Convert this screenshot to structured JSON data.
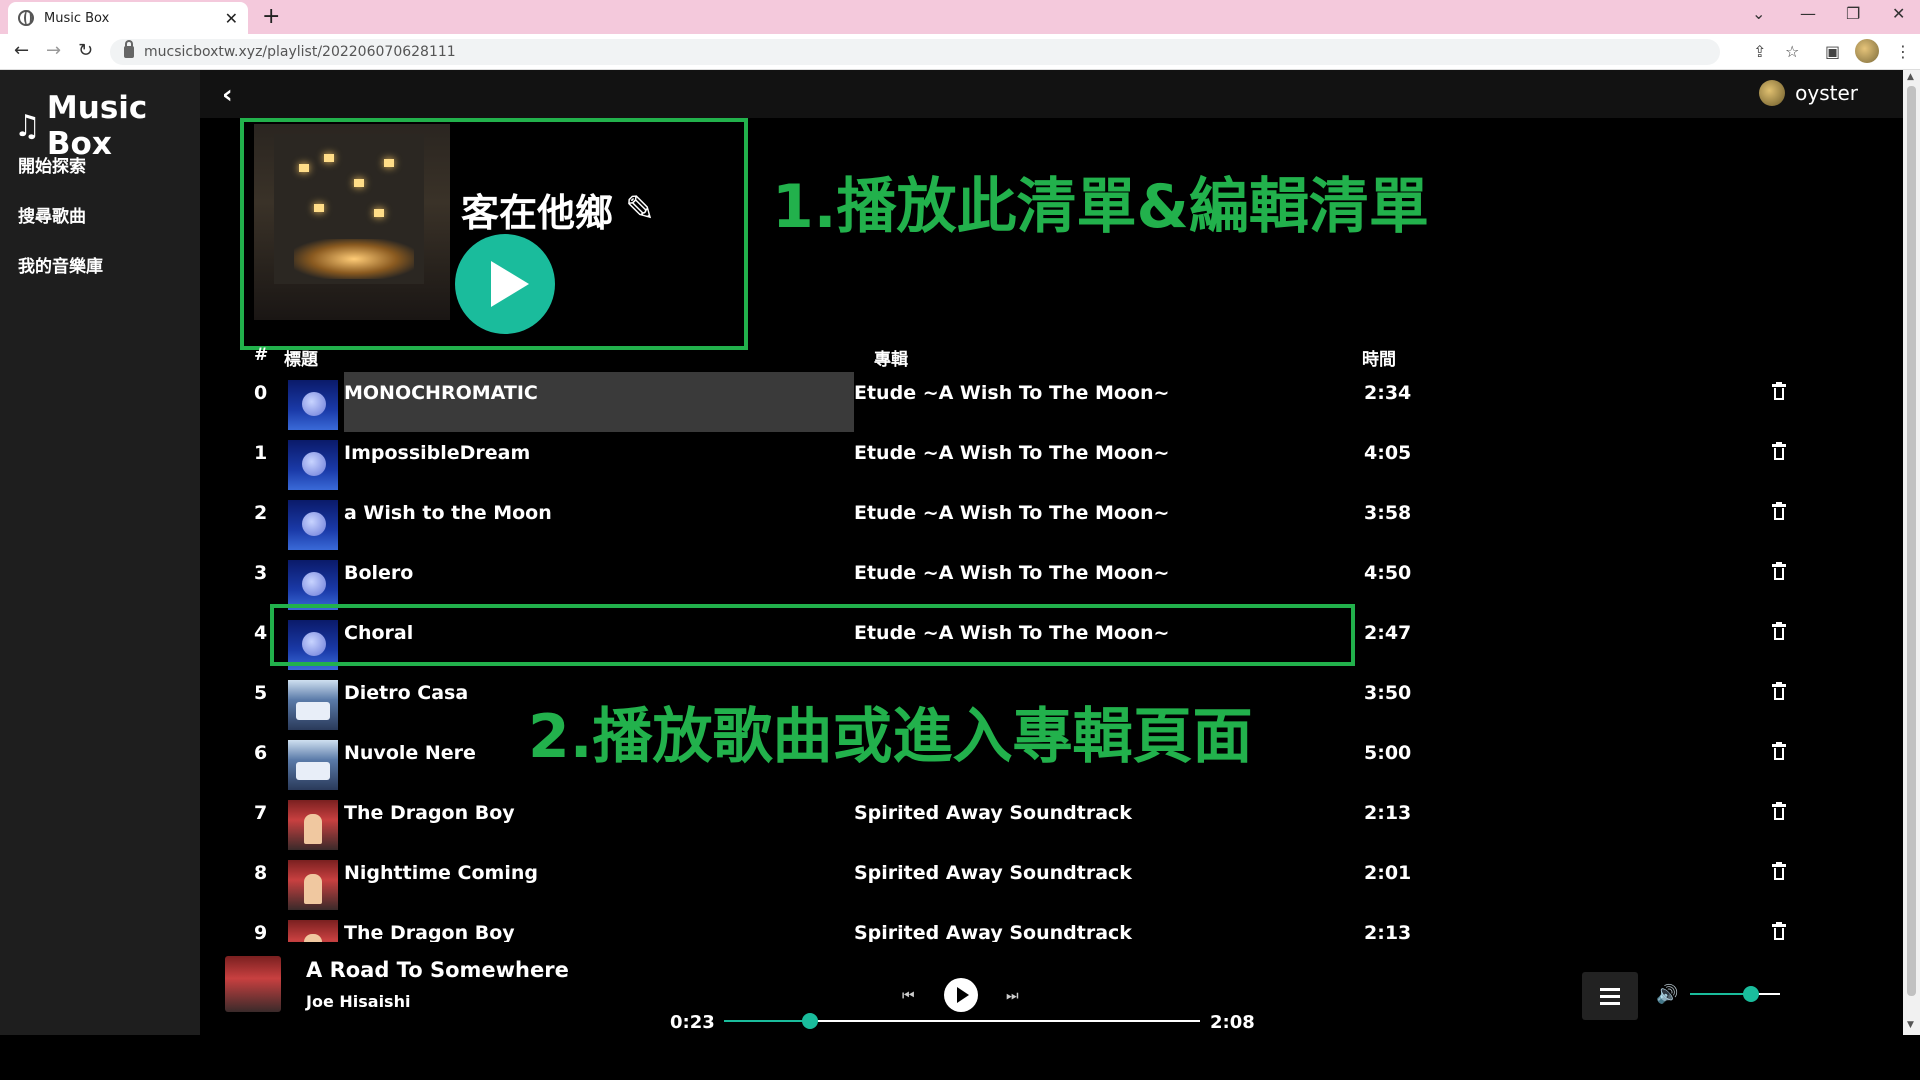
{
  "browser": {
    "tab_title": "Music Box",
    "tab_close": "✕",
    "new_tab": "+",
    "url": "mucsicboxtw.xyz/playlist/202206070628111",
    "win_min": "—",
    "win_restore": "❐",
    "win_close": "✕",
    "win_menu": "⌄"
  },
  "app": {
    "logo": "Music Box",
    "logo_icon": "♫",
    "sidebar": [
      {
        "label": "開始探索"
      },
      {
        "label": "搜尋歌曲"
      },
      {
        "label": "我的音樂庫"
      }
    ],
    "back_icon": "‹",
    "username": "oyster"
  },
  "playlist": {
    "title": "客在他鄉",
    "edit_icon": "✎"
  },
  "annotations": {
    "first": "1.播放此清單&編輯清單",
    "second": "2.播放歌曲或進入專輯頁面"
  },
  "table": {
    "headers": {
      "index": "#",
      "title": "標題",
      "album": "專輯",
      "time": "時間"
    },
    "rows": [
      {
        "index": "0",
        "title": "MONOCHROMATIC",
        "album": "Etude ~A Wish To The Moon~",
        "time": "2:34",
        "art": "moon"
      },
      {
        "index": "1",
        "title": "ImpossibleDream",
        "album": "Etude ~A Wish To The Moon~",
        "time": "4:05",
        "art": "moon"
      },
      {
        "index": "2",
        "title": "a Wish to the Moon",
        "album": "Etude ~A Wish To The Moon~",
        "time": "3:58",
        "art": "moon"
      },
      {
        "index": "3",
        "title": "Bolero",
        "album": "Etude ~A Wish To The Moon~",
        "time": "4:50",
        "art": "moon"
      },
      {
        "index": "4",
        "title": "Choral",
        "album": "Etude ~A Wish To The Moon~",
        "time": "2:47",
        "art": "moon"
      },
      {
        "index": "5",
        "title": "Dietro Casa",
        "album": "",
        "time": "3:50",
        "art": "manga"
      },
      {
        "index": "6",
        "title": "Nuvole Nere",
        "album": "",
        "time": "5:00",
        "art": "manga"
      },
      {
        "index": "7",
        "title": "The Dragon Boy",
        "album": "Spirited Away Soundtrack",
        "time": "2:13",
        "art": "chihiro"
      },
      {
        "index": "8",
        "title": "Nighttime Coming",
        "album": "Spirited Away Soundtrack",
        "time": "2:01",
        "art": "chihiro"
      },
      {
        "index": "9",
        "title": "The Dragon Boy",
        "album": "Spirited Away Soundtrack",
        "time": "2:13",
        "art": "chihiro"
      }
    ]
  },
  "player": {
    "track": "A Road To Somewhere",
    "artist": "Joe Hisaishi",
    "elapsed": "0:23",
    "duration": "2:08",
    "progress_fraction": 0.18,
    "volume_fraction": 0.68,
    "prev_icon": "⏮",
    "next_icon": "⏭",
    "volume_icon": "🔊"
  },
  "colors": {
    "accent": "#1abc9c",
    "annotation": "#22b14c",
    "sidebar_bg": "#1e1e1e",
    "tabbar_bg": "#f4c9dc"
  }
}
